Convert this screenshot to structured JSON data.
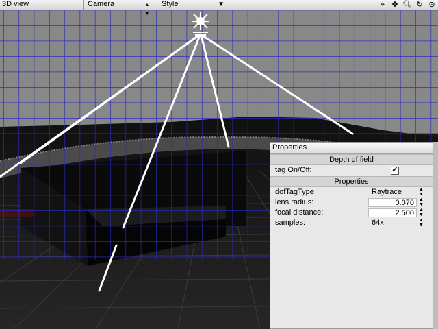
{
  "toolbar": {
    "view_label": "3D view",
    "camera_label": "Camera",
    "style_label": "Style"
  },
  "properties": {
    "title": "Properties",
    "section_dof": "Depth of field",
    "tag_label": "tag On/Off:",
    "tag_checked": true,
    "section_props": "Properties",
    "rows": {
      "dof_type": {
        "label": "dofTagType:",
        "value": "Raytrace"
      },
      "lens_radius": {
        "label": "lens radius:",
        "value": "0.070"
      },
      "focal_distance": {
        "label": "focal distance:",
        "value": "2.500"
      },
      "samples": {
        "label": "samples:",
        "value": "64x"
      }
    }
  },
  "colors": {
    "sky": "#888888",
    "grid": "#2a2ab8",
    "toolbar": "#e4e4e4",
    "panel": "#e8e8e8"
  }
}
